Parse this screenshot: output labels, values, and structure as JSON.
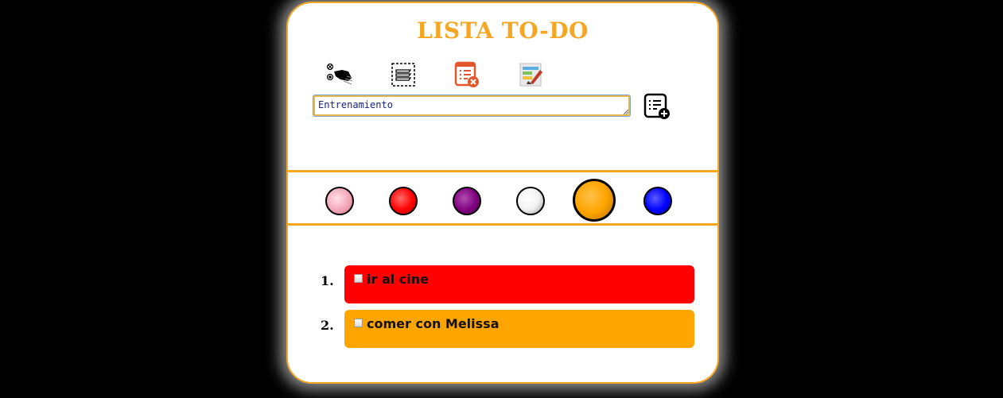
{
  "app": {
    "title": "LISTA TO-DO"
  },
  "toolbar": {
    "tools": [
      {
        "icon": "check-hand-icon"
      },
      {
        "icon": "select-all-icon"
      },
      {
        "icon": "delete-list-icon"
      },
      {
        "icon": "edit-list-icon"
      }
    ]
  },
  "input": {
    "value": "Entrenamiento"
  },
  "add_button": {
    "icon": "add-task-icon"
  },
  "palette": {
    "colors": [
      {
        "name": "pink",
        "hex": "#f4a7b9",
        "selected": false
      },
      {
        "name": "red",
        "hex": "#ff0000",
        "selected": false
      },
      {
        "name": "purple",
        "hex": "#800080",
        "selected": false
      },
      {
        "name": "white",
        "hex": "#ffffff",
        "selected": false
      },
      {
        "name": "orange",
        "hex": "#ffa500",
        "selected": true
      },
      {
        "name": "blue",
        "hex": "#0000ff",
        "selected": false
      }
    ]
  },
  "tasks": [
    {
      "number": "1.",
      "text": "ir al cine",
      "color": "#ff0000",
      "checked": false
    },
    {
      "number": "2.",
      "text": "comer con Melissa",
      "color": "#ffa500",
      "checked": false
    }
  ],
  "theme": {
    "accent": "#f5a623"
  }
}
